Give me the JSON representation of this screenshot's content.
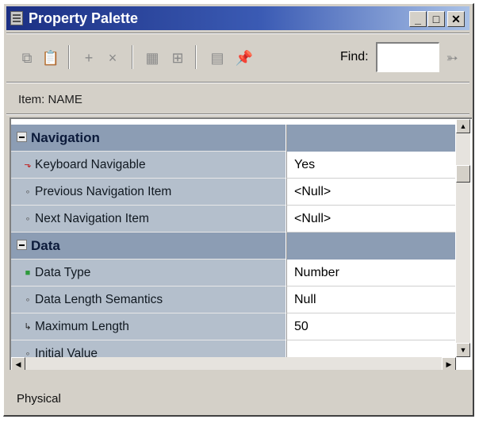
{
  "window": {
    "title": "Property Palette"
  },
  "title_buttons": {
    "minimize": "_",
    "maximize": "□",
    "close": "✕"
  },
  "toolbar": {
    "icons": [
      {
        "name": "copy-properties-icon",
        "glyph": "⧉"
      },
      {
        "name": "paste-properties-icon",
        "glyph": "📋"
      },
      {
        "name": "add-property-icon",
        "glyph": "+"
      },
      {
        "name": "delete-property-icon",
        "glyph": "×"
      },
      {
        "name": "union-intersection-icon",
        "glyph": "▦"
      },
      {
        "name": "property-class-icon",
        "glyph": "⊞"
      },
      {
        "name": "inherit-icon",
        "glyph": "▤"
      },
      {
        "name": "freeze-pin-icon",
        "glyph": "📌"
      },
      {
        "name": "find-next-icon",
        "glyph": "➳"
      }
    ],
    "find_label": "Find:",
    "find_value": ""
  },
  "item_label": "Item: NAME",
  "rows": [
    {
      "type": "category",
      "label": "Navigation",
      "value": ""
    },
    {
      "type": "property",
      "marker": "changed",
      "label": "Keyboard Navigable",
      "value": "Yes"
    },
    {
      "type": "property",
      "marker": "default",
      "label": "Previous Navigation Item",
      "value": "<Null>"
    },
    {
      "type": "property",
      "marker": "default",
      "label": "Next Navigation Item",
      "value": "<Null>"
    },
    {
      "type": "category",
      "label": "Data",
      "value": ""
    },
    {
      "type": "property",
      "marker": "set",
      "label": "Data Type",
      "value": "Number"
    },
    {
      "type": "property",
      "marker": "default",
      "label": "Data Length Semantics",
      "value": "Null"
    },
    {
      "type": "property",
      "marker": "inherited",
      "label": "Maximum Length",
      "value": "50"
    },
    {
      "type": "property",
      "marker": "default",
      "label": "Initial Value",
      "value": ""
    }
  ],
  "markers": {
    "changed": {
      "glyph": "⬎",
      "color": "#c02020"
    },
    "default": {
      "glyph": "∘",
      "color": "#555555"
    },
    "set": {
      "glyph": "■",
      "color": "#2e9a3c"
    },
    "inherited": {
      "glyph": "↳",
      "color": "#1a1a1a"
    }
  },
  "scrollbars": {
    "up": "▲",
    "down": "▼",
    "left": "◀",
    "right": "▶"
  },
  "status": {
    "text": "Physical"
  }
}
